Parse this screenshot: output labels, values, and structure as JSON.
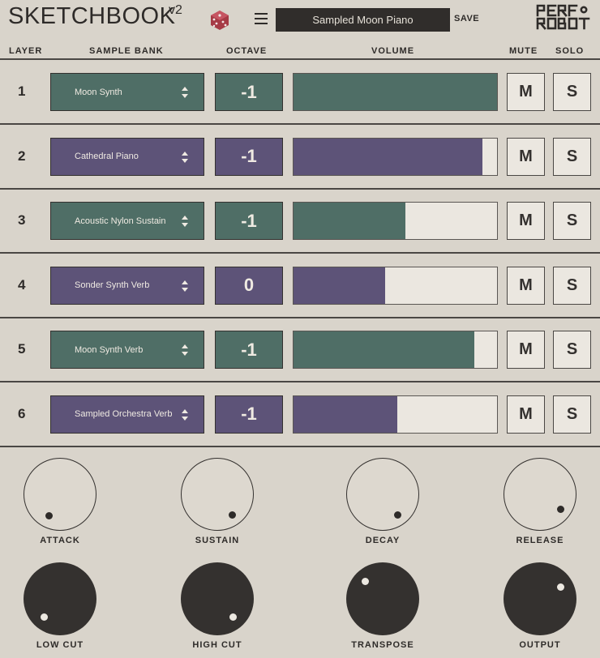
{
  "header": {
    "title": "SKETCHBOOK",
    "version": "v2",
    "preset_name": "Sampled Moon Piano",
    "save_label": "SAVE",
    "logo_text": "PERF ROBOT"
  },
  "columns": {
    "layer": "LAYER",
    "sample_bank": "SAMPLE BANK",
    "octave": "OCTAVE",
    "volume": "VOLUME",
    "mute": "MUTE",
    "solo": "SOLO"
  },
  "colors": {
    "green": "#4f6e66",
    "purple": "#5d5378",
    "dark": "#302d2b",
    "background": "#d9d4cb"
  },
  "layers": [
    {
      "number": "1",
      "bank": "Moon Synth",
      "octave": "-1",
      "volume": 1.0,
      "color": "green",
      "mute": "M",
      "solo": "S"
    },
    {
      "number": "2",
      "bank": "Cathedral Piano",
      "octave": "-1",
      "volume": 0.93,
      "color": "purple",
      "mute": "M",
      "solo": "S"
    },
    {
      "number": "3",
      "bank": "Acoustic Nylon Sustain",
      "octave": "-1",
      "volume": 0.55,
      "color": "green",
      "mute": "M",
      "solo": "S"
    },
    {
      "number": "4",
      "bank": "Sonder Synth Verb",
      "octave": "0",
      "volume": 0.45,
      "color": "purple",
      "mute": "M",
      "solo": "S"
    },
    {
      "number": "5",
      "bank": "Moon Synth Verb",
      "octave": "-1",
      "volume": 0.89,
      "color": "green",
      "mute": "M",
      "solo": "S"
    },
    {
      "number": "6",
      "bank": "Sampled Orchestra Verb",
      "octave": "-1",
      "volume": 0.51,
      "color": "purple",
      "mute": "M",
      "solo": "S"
    }
  ],
  "knobs": [
    {
      "label": "ATTACK",
      "style": "light",
      "angle_deg": 210
    },
    {
      "label": "SUSTAIN",
      "style": "light",
      "angle_deg": 145
    },
    {
      "label": "DECAY",
      "style": "light",
      "angle_deg": 145
    },
    {
      "label": "RELEASE",
      "style": "light",
      "angle_deg": 125
    },
    {
      "label": "LOW CUT",
      "style": "dark",
      "angle_deg": 220
    },
    {
      "label": "HIGH CUT",
      "style": "dark",
      "angle_deg": 140
    },
    {
      "label": "TRANSPOSE",
      "style": "dark",
      "angle_deg": 315
    },
    {
      "label": "OUTPUT",
      "style": "dark",
      "angle_deg": 60
    }
  ]
}
